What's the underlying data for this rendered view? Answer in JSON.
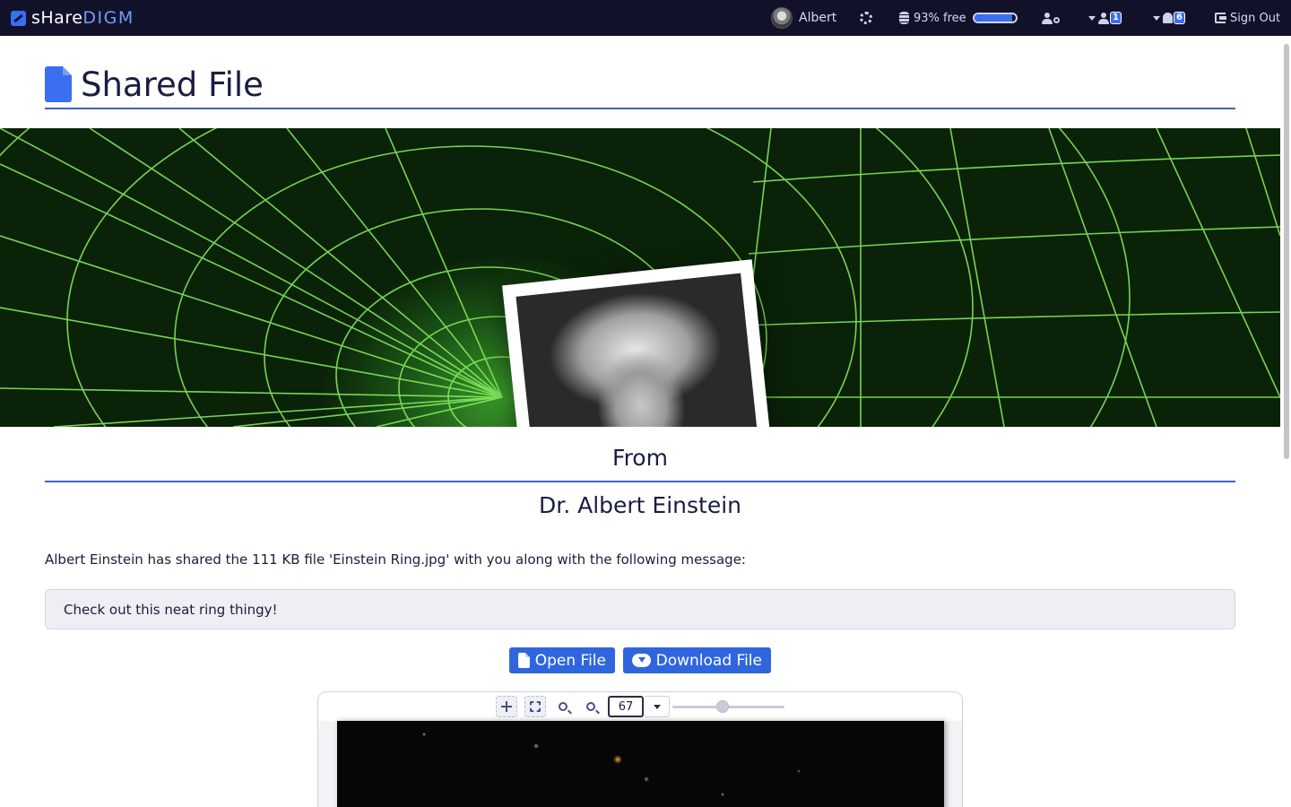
{
  "app": {
    "brand_part1": "sHare",
    "brand_part2": "DIGM"
  },
  "navbar": {
    "user_name": "Albert",
    "storage_text": "93% free",
    "storage_free_fraction": 0.93,
    "contacts_badge": "1",
    "notifications_badge": "6",
    "sign_out_label": "Sign Out"
  },
  "page": {
    "title": "Shared File"
  },
  "share": {
    "from_label": "From",
    "author_name": "Dr. Albert Einstein",
    "description": "Albert Einstein has shared the 111 KB file 'Einstein Ring.jpg' with you along with the following message:",
    "message": "Check out this neat ring thingy!",
    "open_button_label": "Open File",
    "download_button_label": "Download File"
  },
  "viewer": {
    "zoom_value": "67",
    "zoom_slider_fraction": 0.45
  },
  "colors": {
    "navbar_bg": "#11122a",
    "accent": "#2f66e0",
    "title_rule": "#3f63c4"
  }
}
